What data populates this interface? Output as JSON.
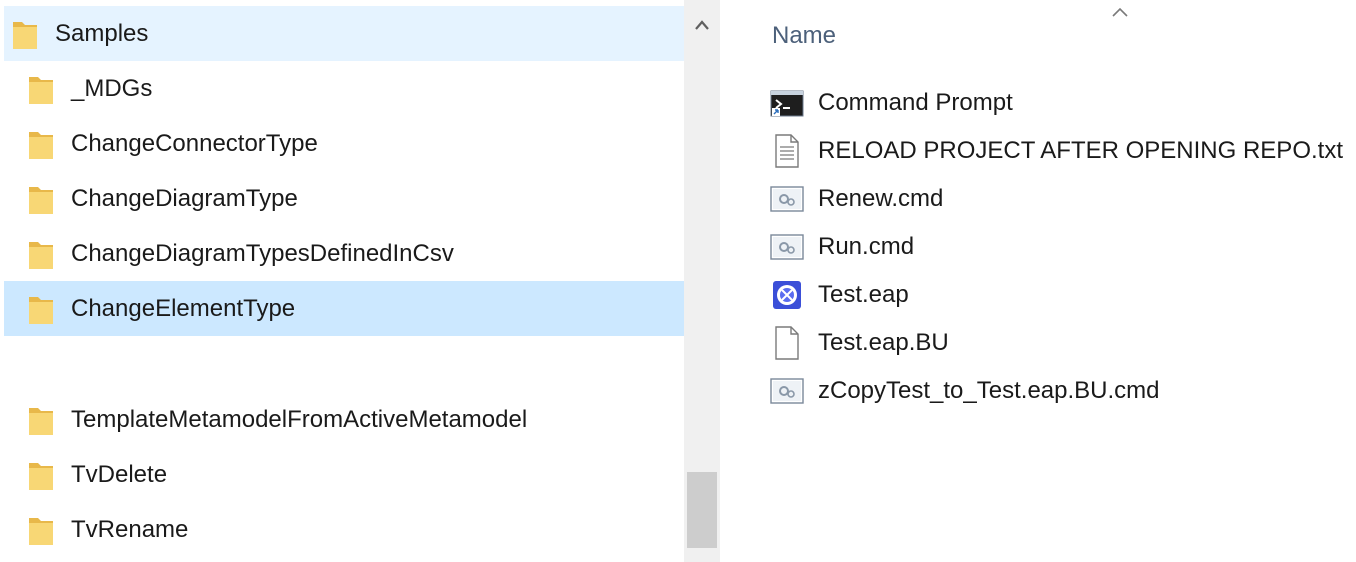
{
  "nav": {
    "items": [
      {
        "label": "Samples",
        "state": "hovered"
      },
      {
        "label": "_MDGs"
      },
      {
        "label": "ChangeConnectorType"
      },
      {
        "label": "ChangeDiagramType"
      },
      {
        "label": "ChangeDiagramTypesDefinedInCsv"
      },
      {
        "label": "ChangeElementType",
        "state": "selected"
      },
      {
        "label": "TemplateMetamodelFromActiveMetamodel"
      },
      {
        "label": "TvDelete"
      },
      {
        "label": "TvRename"
      }
    ]
  },
  "scrollbar": {
    "up_glyph": "^"
  },
  "file_list": {
    "column_header": "Name",
    "sort_glyph": "^",
    "files": [
      {
        "name": "Command Prompt",
        "icon": "command-prompt-icon"
      },
      {
        "name": "RELOAD PROJECT AFTER OPENING REPO.txt",
        "icon": "text-file-icon"
      },
      {
        "name": "Renew.cmd",
        "icon": "cmd-file-icon"
      },
      {
        "name": "Run.cmd",
        "icon": "cmd-file-icon"
      },
      {
        "name": "Test.eap",
        "icon": "eap-file-icon"
      },
      {
        "name": "Test.eap.BU",
        "icon": "blank-file-icon"
      },
      {
        "name": "zCopyTest_to_Test.eap.BU.cmd",
        "icon": "cmd-file-icon"
      }
    ]
  },
  "colors": {
    "selected": "#cce8ff",
    "hovered": "#e5f3ff",
    "folder": "#f8d775",
    "header_text": "#4c607a"
  }
}
